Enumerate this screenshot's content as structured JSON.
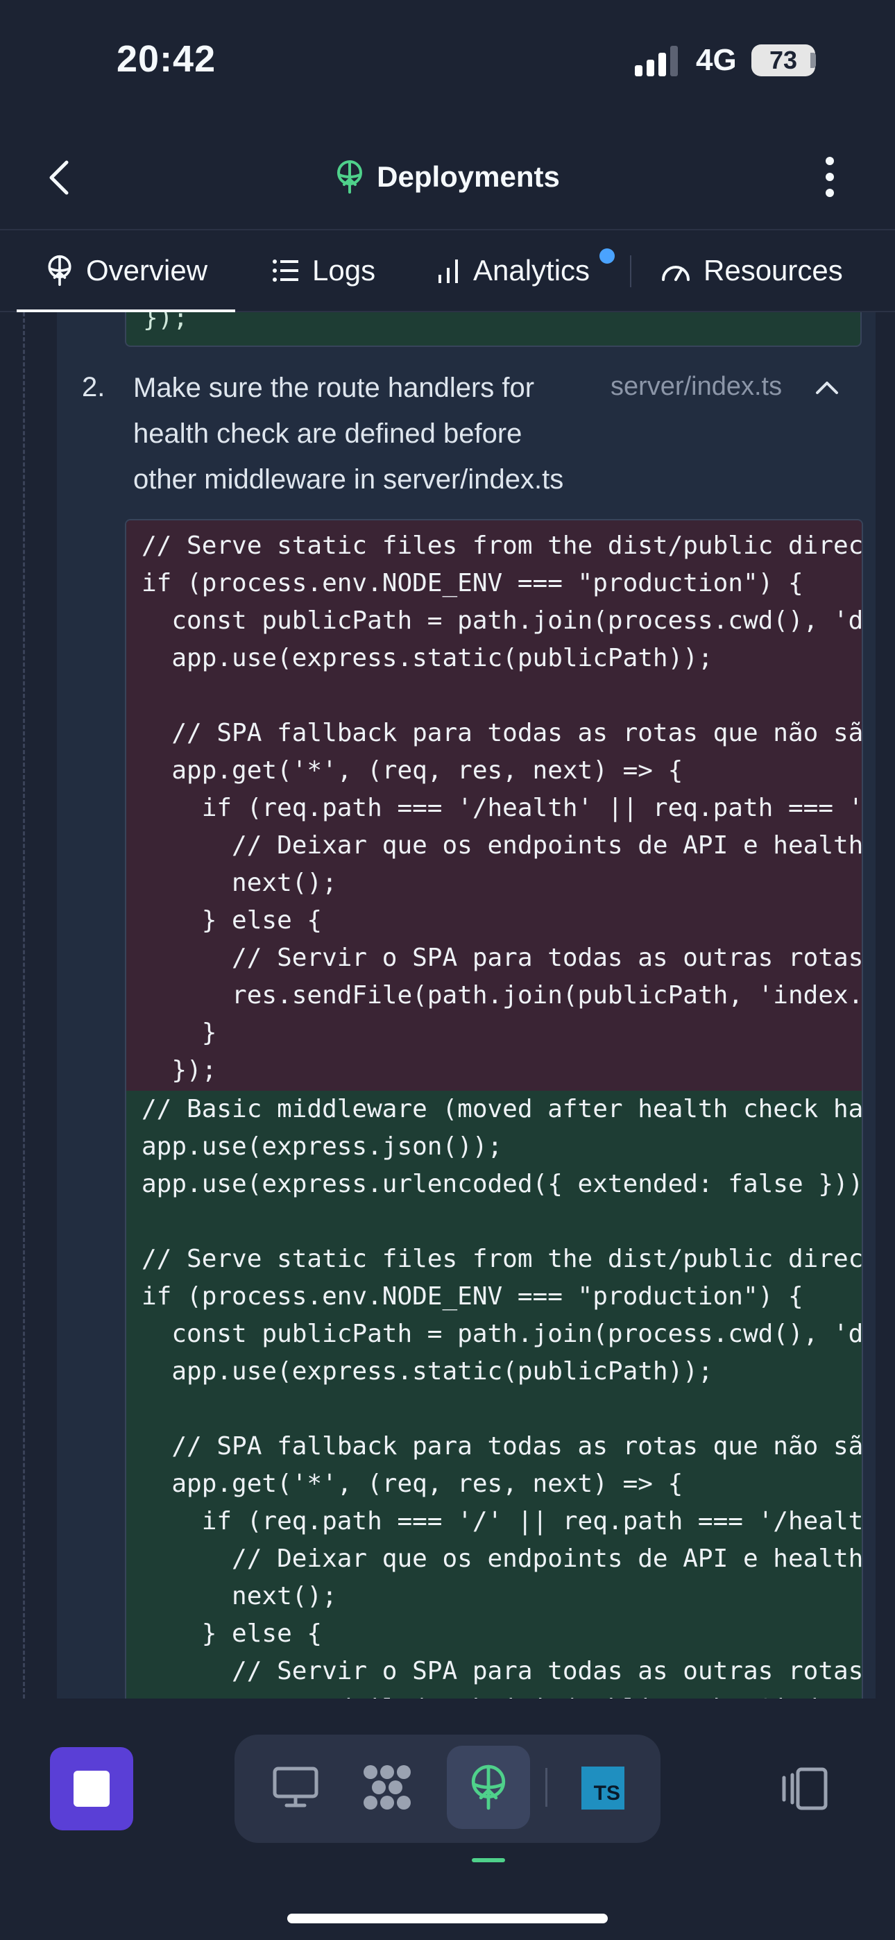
{
  "status_bar": {
    "time": "20:42",
    "network": "4G",
    "battery": "73"
  },
  "header": {
    "title": "Deployments"
  },
  "tabs": [
    {
      "label": "Overview",
      "icon": "deployment-icon",
      "active": true
    },
    {
      "label": "Logs",
      "icon": "list-icon"
    },
    {
      "label": "Analytics",
      "icon": "bar-chart-icon",
      "badge": "notification-dot"
    },
    {
      "label": "Resources",
      "icon": "gauge-icon"
    }
  ],
  "previous_code_tail": "});",
  "step": {
    "number": "2.",
    "text": "Make sure the route handlers for health check are defined before other middleware in server/index.ts",
    "file": "server/index.ts"
  },
  "diff": {
    "removed": [
      "// Serve static files from the dist/public direc",
      "if (process.env.NODE_ENV === \"production\") {",
      "  const publicPath = path.join(process.cwd(), 'd",
      "  app.use(express.static(publicPath));",
      "",
      "  // SPA fallback para todas as rotas que não sã",
      "  app.get('*', (req, res, next) => {",
      "    if (req.path === '/health' || req.path === '",
      "      // Deixar que os endpoints de API e health",
      "      next();",
      "    } else {",
      "      // Servir o SPA para todas as outras rotas",
      "      res.sendFile(path.join(publicPath, 'index.",
      "    }",
      "  });"
    ],
    "added": [
      "// Basic middleware (moved after health check ha",
      "app.use(express.json());",
      "app.use(express.urlencoded({ extended: false }))",
      "",
      "// Serve static files from the dist/public direc",
      "if (process.env.NODE_ENV === \"production\") {",
      "  const publicPath = path.join(process.cwd(), 'd",
      "  app.use(express.static(publicPath));",
      "",
      "  // SPA fallback para todas as rotas que não sã",
      "  app.get('*', (req, res, next) => {",
      "    if (req.path === '/' || req.path === '/healt",
      "      // Deixar que os endpoints de API e health",
      "      next();",
      "    } else {",
      "      // Servir o SPA para todas as outras rotas",
      "      res.sendFile(path.join(publicPath, 'index."
    ]
  },
  "dock": {
    "tools": [
      "desktop-icon",
      "extensions-icon",
      "deployment-icon",
      "typescript-icon"
    ],
    "typescript_badge": "TS"
  },
  "colors": {
    "background": "#1c2333",
    "removed_bg": "#3a2434",
    "added_bg": "#1e3d34",
    "accent_green": "#4fd18b",
    "stop_button": "#5a3fd6"
  }
}
